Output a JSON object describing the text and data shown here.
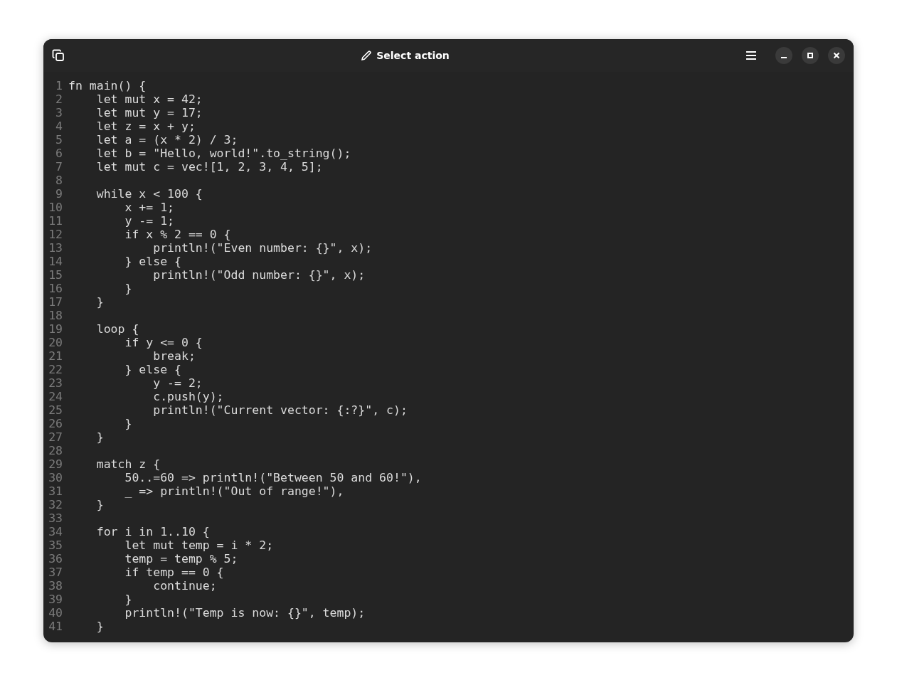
{
  "window": {
    "title": "Select action"
  },
  "lines": [
    {
      "number": "1",
      "text": "fn main() {"
    },
    {
      "number": "2",
      "text": "    let mut x = 42;"
    },
    {
      "number": "3",
      "text": "    let mut y = 17;"
    },
    {
      "number": "4",
      "text": "    let z = x + y;"
    },
    {
      "number": "5",
      "text": "    let a = (x * 2) / 3;"
    },
    {
      "number": "6",
      "text": "    let b = \"Hello, world!\".to_string();"
    },
    {
      "number": "7",
      "text": "    let mut c = vec![1, 2, 3, 4, 5];"
    },
    {
      "number": "8"
    },
    {
      "number": "9",
      "text": "    while x < 100 {"
    },
    {
      "number": "10",
      "text": "        x += 1;"
    },
    {
      "number": "11",
      "text": "        y -= 1;"
    },
    {
      "number": "12",
      "text": "        if x % 2 == 0 {"
    },
    {
      "number": "13",
      "text": "            println!(\"Even number: {}\", x);"
    },
    {
      "number": "14",
      "text": "        } else {"
    },
    {
      "number": "15",
      "text": "            println!(\"Odd number: {}\", x);"
    },
    {
      "number": "16",
      "text": "        }"
    },
    {
      "number": "17",
      "text": "    }"
    },
    {
      "number": "18"
    },
    {
      "number": "19",
      "text": "    loop {"
    },
    {
      "number": "20",
      "text": "        if y <= 0 {"
    },
    {
      "number": "21",
      "text": "            break;"
    },
    {
      "number": "22",
      "text": "        } else {"
    },
    {
      "number": "23",
      "text": "            y -= 2;"
    },
    {
      "number": "24",
      "text": "            c.push(y);"
    },
    {
      "number": "25",
      "text": "            println!(\"Current vector: {:?}\", c);"
    },
    {
      "number": "26",
      "text": "        }"
    },
    {
      "number": "27",
      "text": "    }"
    },
    {
      "number": "28"
    },
    {
      "number": "29",
      "text": "    match z {"
    },
    {
      "number": "30",
      "text": "        50..=60 => println!(\"Between 50 and 60!\"),"
    },
    {
      "number": "31",
      "text": "        _ => println!(\"Out of range!\"),"
    },
    {
      "number": "32",
      "text": "    }"
    },
    {
      "number": "33"
    },
    {
      "number": "34",
      "text": "    for i in 1..10 {"
    },
    {
      "number": "35",
      "text": "        let mut temp = i * 2;"
    },
    {
      "number": "36",
      "text": "        temp = temp % 5;"
    },
    {
      "number": "37",
      "text": "        if temp == 0 {"
    },
    {
      "number": "38",
      "text": "            continue;"
    },
    {
      "number": "39",
      "text": "        }"
    },
    {
      "number": "40",
      "text": "        println!(\"Temp is now: {}\", temp);"
    },
    {
      "number": "41",
      "text": "    }"
    }
  ]
}
